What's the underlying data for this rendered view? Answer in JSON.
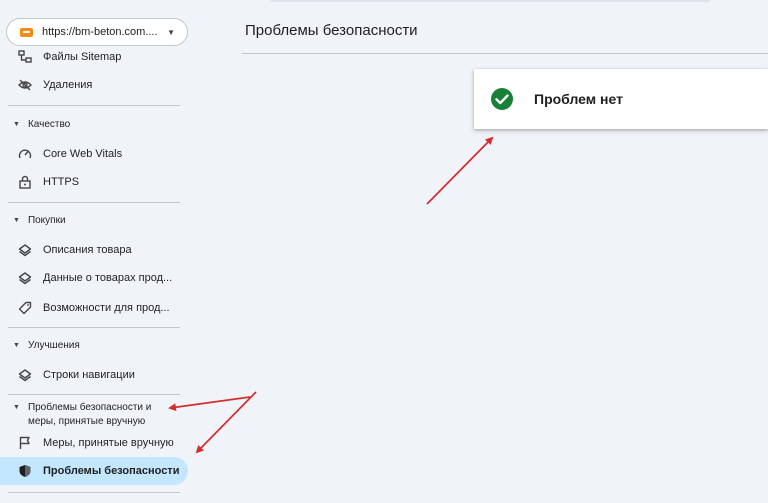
{
  "property": {
    "url": "https://bm-beton.com...."
  },
  "nav": {
    "sitemaps": "Файлы Sitemap",
    "removals": "Удаления",
    "quality_section": "Качество",
    "cwv": "Core Web Vitals",
    "https": "HTTPS",
    "shopping_section": "Покупки",
    "product_snippets": "Описания товара",
    "merchant_listings": "Данные о товарах прод...",
    "shopping_tab": "Возможности для прод...",
    "enhancements_section": "Улучшения",
    "breadcrumbs": "Строки навигации",
    "security_section": "Проблемы безопасности и меры, принятые вручную",
    "manual_actions": "Меры, принятые вручную",
    "security_issues": "Проблемы безопасности"
  },
  "main": {
    "title": "Проблемы безопасности",
    "status_text": "Проблем нет"
  },
  "colors": {
    "active_bg": "#c2e7ff",
    "success": "#188038",
    "annotation_arrow": "#d32f2f"
  }
}
